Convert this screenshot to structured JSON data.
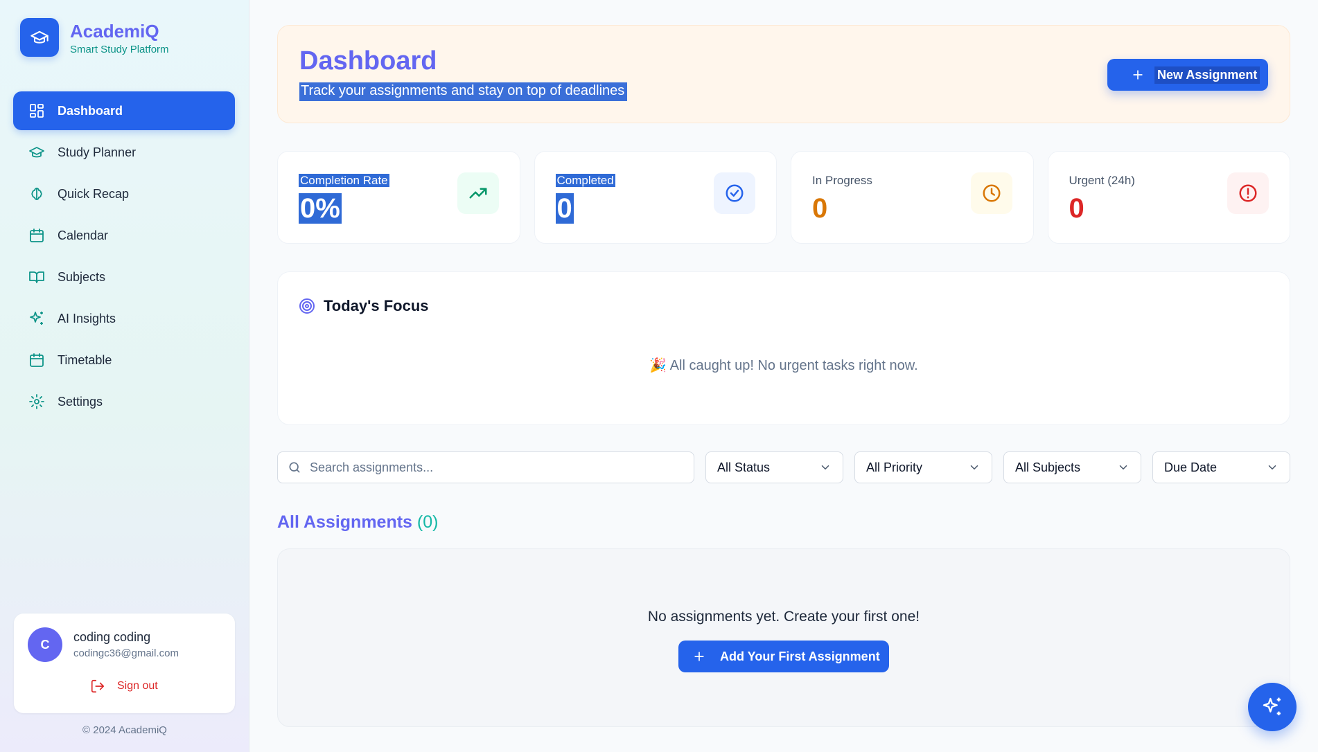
{
  "brand": {
    "title": "AcademiQ",
    "subtitle": "Smart Study Platform",
    "logo_icon": "graduation-cap-icon"
  },
  "sidebar": {
    "items": [
      {
        "label": "Dashboard",
        "icon": "layout-grid-icon",
        "active": true
      },
      {
        "label": "Study Planner",
        "icon": "graduation-cap-icon"
      },
      {
        "label": "Quick Recap",
        "icon": "brain-icon"
      },
      {
        "label": "Calendar",
        "icon": "calendar-icon"
      },
      {
        "label": "Subjects",
        "icon": "book-open-icon"
      },
      {
        "label": "AI Insights",
        "icon": "sparkles-icon"
      },
      {
        "label": "Timetable",
        "icon": "calendar-icon"
      },
      {
        "label": "Settings",
        "icon": "gear-icon"
      }
    ]
  },
  "user": {
    "initial": "C",
    "name": "coding coding",
    "email": "codingc36@gmail.com",
    "signout_label": "Sign out"
  },
  "footer": {
    "copyright": "© 2024 AcademiQ"
  },
  "header": {
    "title": "Dashboard",
    "subtitle": "Track your assignments and stay on top of deadlines",
    "new_button_label": "New Assignment"
  },
  "stats": [
    {
      "label": "Completion Rate",
      "value": "0%",
      "color": "#1e293b",
      "icon": "trending-up-icon"
    },
    {
      "label": "Completed",
      "value": "0",
      "color": "#1e293b",
      "icon": "check-circle-icon"
    },
    {
      "label": "In Progress",
      "value": "0",
      "color": "#d97706",
      "icon": "clock-icon"
    },
    {
      "label": "Urgent (24h)",
      "value": "0",
      "color": "#dc2626",
      "icon": "alert-circle-icon"
    }
  ],
  "focus": {
    "title": "Today's Focus",
    "empty_message": "🎉 All caught up! No urgent tasks right now."
  },
  "filters": {
    "search_placeholder": "Search assignments...",
    "status": "All Status",
    "priority": "All Priority",
    "subjects": "All Subjects",
    "sort": "Due Date"
  },
  "assignments": {
    "title": "All Assignments",
    "count": "(0)",
    "empty_message": "No assignments yet. Create your first one!",
    "add_button_label": "Add Your First Assignment"
  },
  "colors": {
    "primary": "#2563eb",
    "accent": "#6366f1",
    "teal": "#0d9488"
  }
}
